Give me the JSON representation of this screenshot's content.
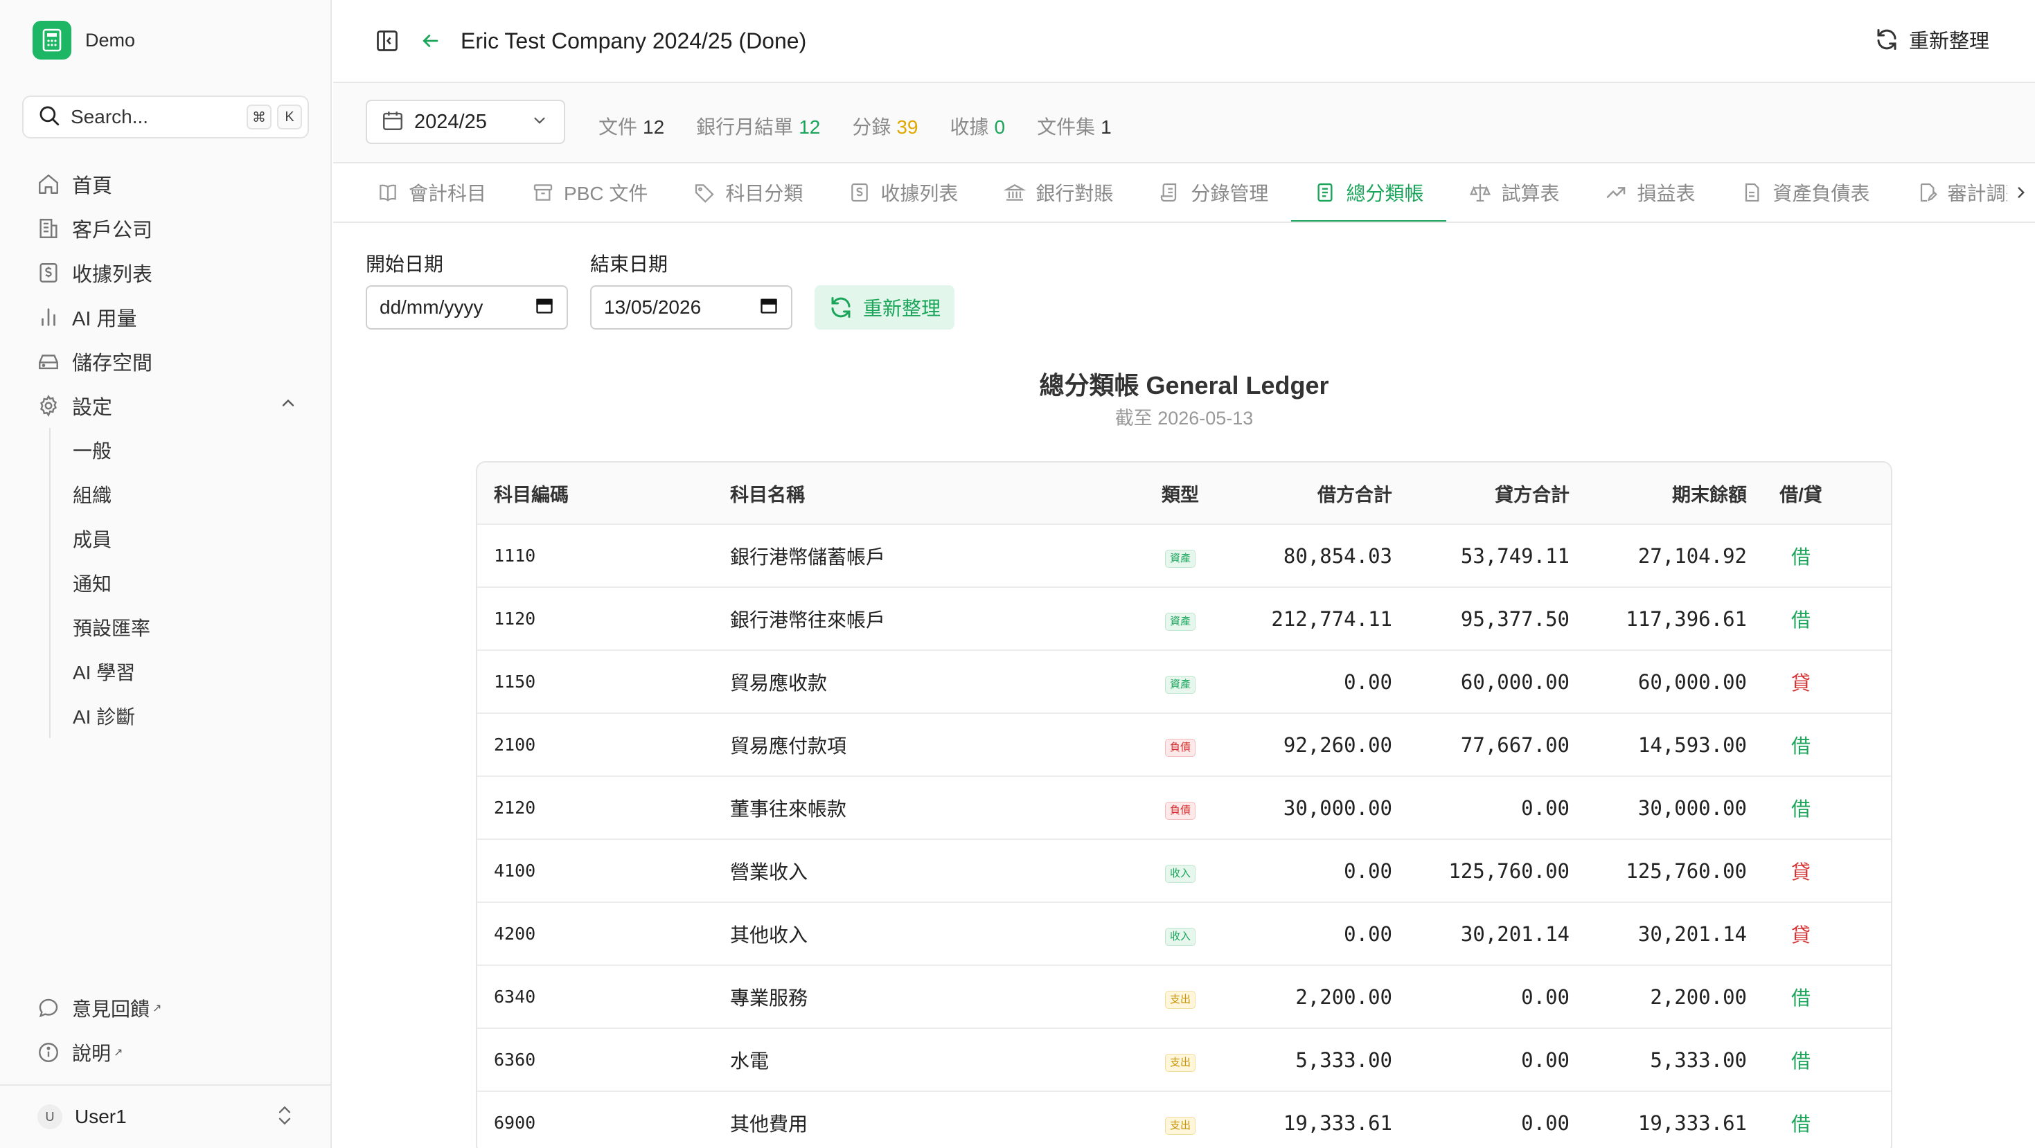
{
  "sidebar": {
    "brand": "Demo",
    "search_placeholder": "Search...",
    "search_keys": [
      "⌘",
      "K"
    ],
    "items": [
      {
        "label": "首頁",
        "icon": "home-icon"
      },
      {
        "label": "客戶公司",
        "icon": "building-icon"
      },
      {
        "label": "收據列表",
        "icon": "receipt-icon"
      },
      {
        "label": "AI 用量",
        "icon": "bar-chart-icon"
      },
      {
        "label": "儲存空間",
        "icon": "storage-icon"
      },
      {
        "label": "設定",
        "icon": "gear-icon"
      }
    ],
    "settings_sub": [
      "一般",
      "組織",
      "成員",
      "通知",
      "預設匯率",
      "AI 學習",
      "AI 診斷"
    ],
    "bottom": [
      {
        "label": "意見回饋",
        "icon": "message-icon"
      },
      {
        "label": "說明",
        "icon": "info-icon"
      }
    ],
    "user": {
      "initial": "U",
      "name": "User1"
    }
  },
  "header": {
    "title": "Eric Test Company 2024/25 (Done)",
    "refresh_label": "重新整理"
  },
  "statbar": {
    "year": "2024/25",
    "stats": [
      {
        "label": "文件",
        "value": "12",
        "color": "#333333"
      },
      {
        "label": "銀行月結單",
        "value": "12",
        "color": "#1aa55a"
      },
      {
        "label": "分錄",
        "value": "39",
        "color": "#e0a800"
      },
      {
        "label": "收據",
        "value": "0",
        "color": "#1aa55a"
      },
      {
        "label": "文件集",
        "value": "1",
        "color": "#333333"
      }
    ]
  },
  "tabs": [
    {
      "label": "會計科目",
      "icon": "book-icon"
    },
    {
      "label": "PBC 文件",
      "icon": "archive-icon"
    },
    {
      "label": "科目分類",
      "icon": "tag-icon"
    },
    {
      "label": "收據列表",
      "icon": "receipt-icon"
    },
    {
      "label": "銀行對賬",
      "icon": "bank-icon"
    },
    {
      "label": "分錄管理",
      "icon": "scroll-icon"
    },
    {
      "label": "總分類帳",
      "icon": "ledger-icon",
      "active": true
    },
    {
      "label": "試算表",
      "icon": "scale-icon"
    },
    {
      "label": "損益表",
      "icon": "trending-up-icon"
    },
    {
      "label": "資產負債表",
      "icon": "file-icon"
    },
    {
      "label": "審計調整",
      "icon": "file-edit-icon"
    }
  ],
  "filters": {
    "start_label": "開始日期",
    "start_value": "dd/mm/yyyy",
    "end_label": "結束日期",
    "end_value": "13/05/2026",
    "refresh_label": "重新整理"
  },
  "ledger": {
    "title": "總分類帳 General Ledger",
    "subtitle": "截至 2026-05-13",
    "columns": [
      "科目編碼",
      "科目名稱",
      "類型",
      "借方合計",
      "貸方合計",
      "期末餘額",
      "借/貸"
    ],
    "rows": [
      {
        "code": "1110",
        "name": "銀行港幣儲蓄帳戶",
        "type": "資產",
        "debit": "80,854.03",
        "credit": "53,749.11",
        "balance": "27,104.92",
        "dc": "借"
      },
      {
        "code": "1120",
        "name": "銀行港幣往來帳戶",
        "type": "資產",
        "debit": "212,774.11",
        "credit": "95,377.50",
        "balance": "117,396.61",
        "dc": "借"
      },
      {
        "code": "1150",
        "name": "貿易應收款",
        "type": "資產",
        "debit": "0.00",
        "credit": "60,000.00",
        "balance": "60,000.00",
        "dc": "貸"
      },
      {
        "code": "2100",
        "name": "貿易應付款項",
        "type": "負債",
        "debit": "92,260.00",
        "credit": "77,667.00",
        "balance": "14,593.00",
        "dc": "借"
      },
      {
        "code": "2120",
        "name": "董事往來帳款",
        "type": "負債",
        "debit": "30,000.00",
        "credit": "0.00",
        "balance": "30,000.00",
        "dc": "借"
      },
      {
        "code": "4100",
        "name": "營業收入",
        "type": "收入",
        "debit": "0.00",
        "credit": "125,760.00",
        "balance": "125,760.00",
        "dc": "貸"
      },
      {
        "code": "4200",
        "name": "其他收入",
        "type": "收入",
        "debit": "0.00",
        "credit": "30,201.14",
        "balance": "30,201.14",
        "dc": "貸"
      },
      {
        "code": "6340",
        "name": "專業服務",
        "type": "支出",
        "debit": "2,200.00",
        "credit": "0.00",
        "balance": "2,200.00",
        "dc": "借"
      },
      {
        "code": "6360",
        "name": "水電",
        "type": "支出",
        "debit": "5,333.00",
        "credit": "0.00",
        "balance": "5,333.00",
        "dc": "借"
      },
      {
        "code": "6900",
        "name": "其他費用",
        "type": "支出",
        "debit": "19,333.61",
        "credit": "0.00",
        "balance": "19,333.61",
        "dc": "借"
      }
    ]
  },
  "colors": {
    "accent": "#1aa55a",
    "debit": "#1aa55a",
    "credit": "#d32f2f",
    "brand": "#1db664"
  }
}
